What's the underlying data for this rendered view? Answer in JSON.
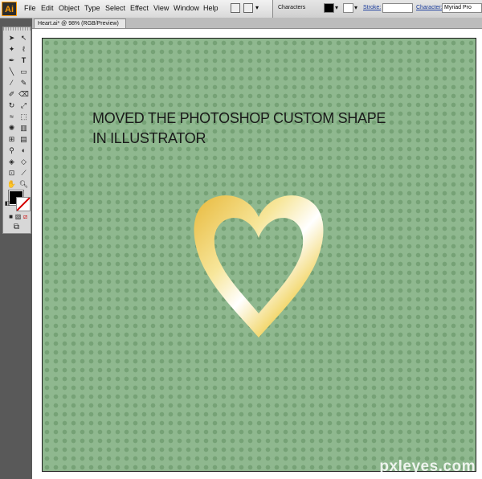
{
  "menubar": {
    "logo": "Ai",
    "items": [
      "File",
      "Edit",
      "Object",
      "Type",
      "Select",
      "Effect",
      "View",
      "Window",
      "Help"
    ]
  },
  "control_bar": {
    "characters_label": "Characters",
    "stroke_label": "Stroke:",
    "character_label": "Character:",
    "font_value": "Myriad Pro"
  },
  "document": {
    "tab_title": "Heart.ai* @ 98% (RGB/Preview)"
  },
  "toolbox": {
    "tools": [
      "selection",
      "direct-selection",
      "magic-wand",
      "lasso",
      "pen",
      "type",
      "line",
      "rectangle",
      "paintbrush",
      "pencil",
      "blob-brush",
      "eraser",
      "rotate",
      "scale",
      "warp",
      "free-transform",
      "symbol-sprayer",
      "column-graph",
      "mesh",
      "gradient",
      "eyedropper",
      "blend",
      "live-paint",
      "live-paint-selection",
      "crop",
      "slice",
      "hand",
      "zoom"
    ],
    "fill_color": "#000000",
    "stroke_color": "#ffffff"
  },
  "canvas": {
    "background_color": "#8fb88f",
    "dot_color": "#76a276",
    "caption_line1": "MOVED THE PHOTOSHOP CUSTOM SHAPE",
    "caption_line2": "IN ILLUSTRATOR",
    "heart_gradient": [
      "#e8b93c",
      "#f7e69a",
      "#ffffff",
      "#f1d25a",
      "#d99a12"
    ]
  },
  "watermark": "pxleyes.com"
}
